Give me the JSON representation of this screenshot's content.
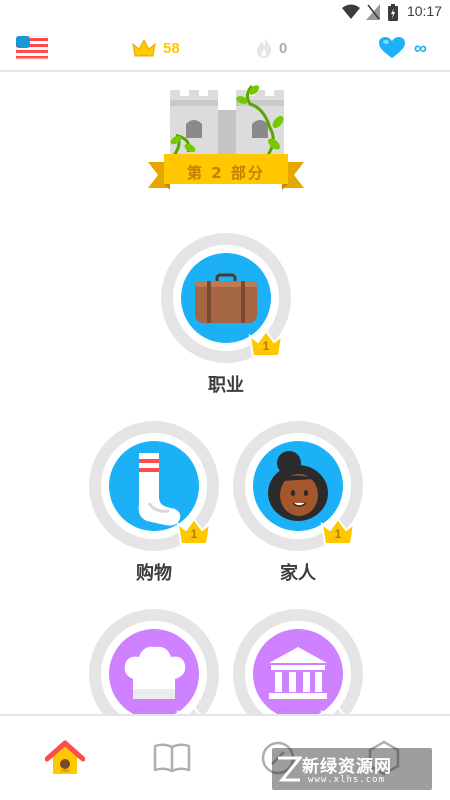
{
  "status_bar": {
    "time": "10:17"
  },
  "top_bar": {
    "language_flag": "us-flag-icon",
    "crowns": "58",
    "streak": "0",
    "hearts": "∞",
    "colors": {
      "crown": "#ffc800",
      "streak": "#afafaf",
      "heart": "#1cb0f6"
    }
  },
  "checkpoint": {
    "label": "第 2 部分"
  },
  "skills": [
    {
      "label": "职业",
      "level": "1",
      "icon": "suitcase-icon"
    },
    {
      "label": "购物",
      "level": "1",
      "icon": "sock-icon"
    },
    {
      "label": "家人",
      "level": "1",
      "icon": "person-icon"
    },
    {
      "label": "",
      "level": "",
      "icon": "chef-hat-icon"
    },
    {
      "label": "",
      "level": "",
      "icon": "bank-icon"
    }
  ],
  "bottom_nav": {
    "items": [
      "home-icon",
      "book-icon",
      "ranking-icon",
      "shield-icon"
    ]
  },
  "watermark": {
    "title": "新绿资源网",
    "url": "www.xlhs.com"
  }
}
